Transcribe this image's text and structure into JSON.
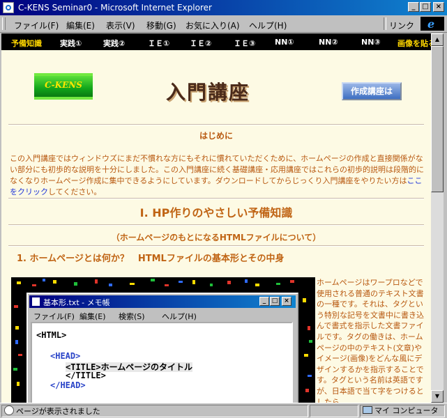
{
  "window": {
    "title": "C-KENS Seminar0 - Microsoft Internet Explorer"
  },
  "menubar": {
    "items": [
      "ファイル(F)",
      "編集(E)",
      "表示(V)",
      "移動(G)",
      "お気に入り(A)",
      "ヘルプ(H)"
    ],
    "links_label": "リンク"
  },
  "nav": {
    "items": [
      "予備知識",
      "実践①",
      "実践②",
      "ＩＥ①",
      "ＩＥ②",
      "ＩＥ③",
      "NN①",
      "NN②",
      "NN③",
      "画像を貼る"
    ]
  },
  "header": {
    "logo_text": "C-KENS",
    "title": "入門講座",
    "right_button": "作成講座は"
  },
  "intro": {
    "heading": "はじめに",
    "text_before_link": "この入門講座ではウィンドウズにまだ不慣れな方にもそれに慣れていただくために、ホームページの作成と直接関係がない部分にも初歩的な説明を十分にしました。この入門講座に続く基礎講座・応用講座ではこれらの初歩的説明は段階的になくなりホームページ作成に集中できるようにしています。ダウンロードしてからじっくり入門講座をやりたい方は",
    "link_text": "ここをクリック",
    "text_after_link": "してください。"
  },
  "section1": {
    "title": "Ⅰ. HP作りのやさしい予備知識",
    "subtitle": "（ホームページのもとになるHTMLファイルについて）",
    "heading": "1. ホームページとは何か？　HTMLファイルの基本形とその中身"
  },
  "notepad": {
    "title": "基本形.txt - メモ帳",
    "menu": [
      "ファイル(F)",
      "編集(E)",
      "検索(S)",
      "ヘルプ(H)"
    ],
    "lines": [
      "<HTML>",
      "<HEAD>",
      "<TITLE>ホームページのタイトル",
      "</TITLE>",
      "</HEAD>"
    ]
  },
  "side_text": "ホームページはワープロなどで使用される普通のテキスト文書の一種です。それは、タグという特別な記号を文書中に書き込んで書式を指示した文書ファイルです。タグの働きは、ホームページの中のテキスト(文章)やイメージ(画像)をどんな風にデザインするかを指示することです。タグという名前は英語ですが、日本語で当て字をつけるとしたら",
  "status": {
    "text": "ページが表示されました",
    "zone": "マイ コンピュータ"
  }
}
